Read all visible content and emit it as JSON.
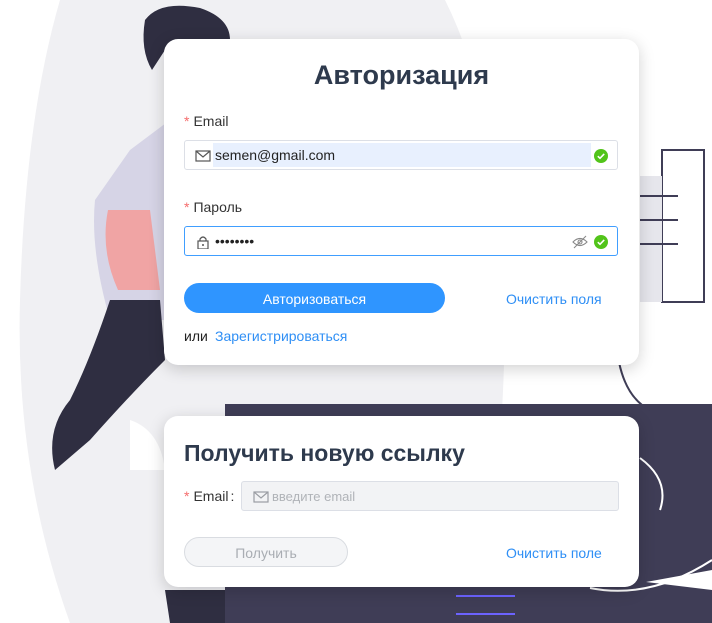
{
  "login": {
    "title": "Авторизация",
    "required_mark": "*",
    "email_label": "Email",
    "email_value": "semen@gmail.com",
    "password_label": "Пароль",
    "password_value": "••••••••",
    "submit_label": "Авторизоваться",
    "clear_label": "Очистить поля",
    "or_text": "или",
    "register_label": "Зарегистрироваться"
  },
  "new_link": {
    "title": "Получить новую ссылку",
    "required_mark": "*",
    "email_label": "Email",
    "label_colon": ":",
    "email_placeholder": "введите email",
    "submit_label": "Получить",
    "clear_label": "Очистить поле"
  },
  "colors": {
    "primary": "#2f95ff",
    "link": "#2f8ff5",
    "valid": "#52c41a",
    "required": "#f56c6c",
    "title": "#2e3a4d",
    "illustration_dark": "#3f3d56",
    "illustration_light": "#f0f0f3"
  },
  "icons": {
    "email": "envelope-icon",
    "password": "lock-icon",
    "valid": "check-circle-icon",
    "visibility": "eye-off-icon"
  }
}
